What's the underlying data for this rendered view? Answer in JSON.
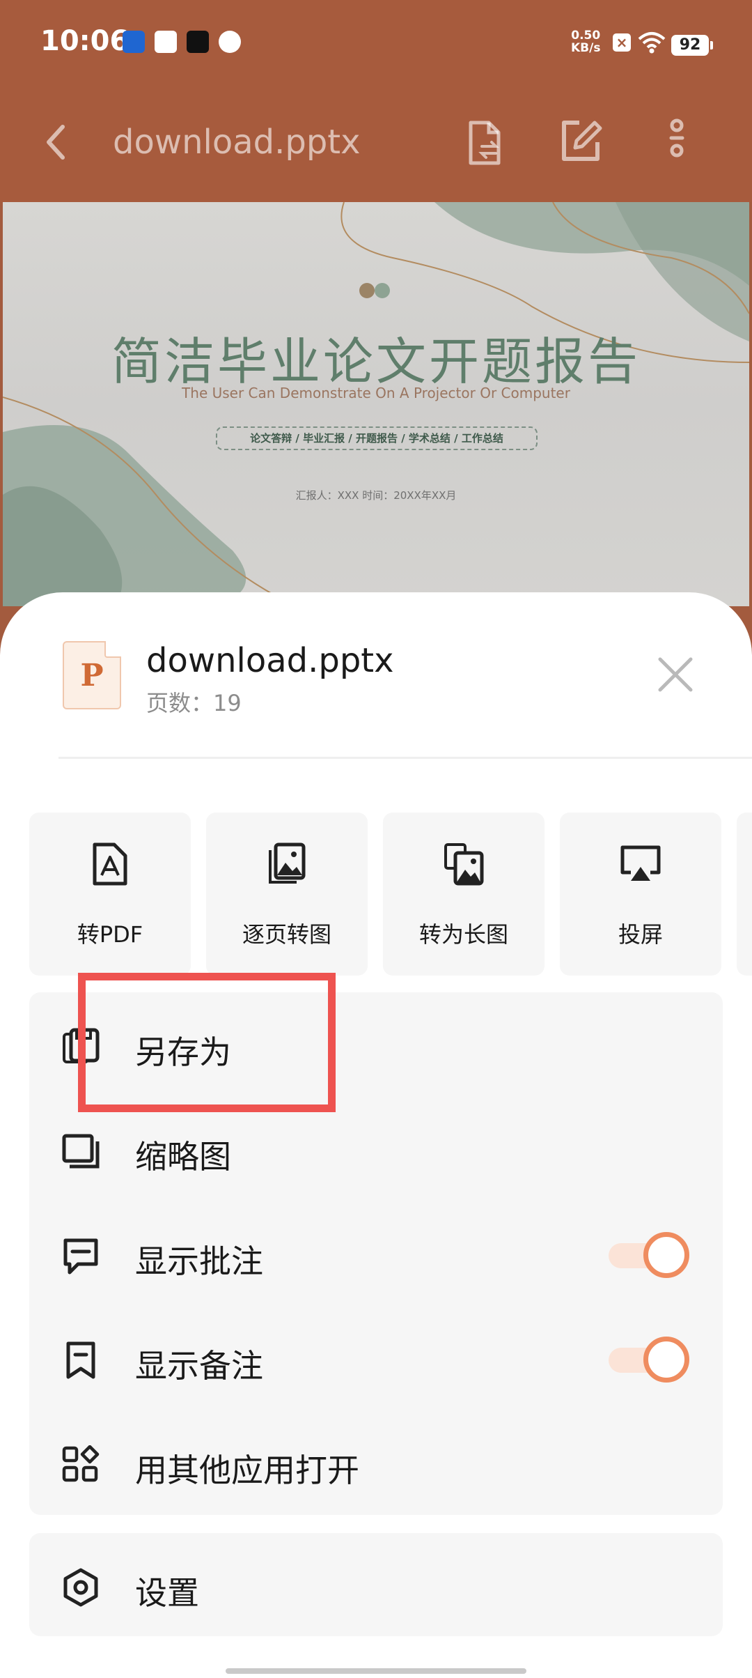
{
  "status_bar": {
    "time": "10:06",
    "net_speed_value": "0.50",
    "net_speed_unit": "KB/s",
    "battery": "92",
    "icons": [
      "baidu-icon",
      "mail-icon",
      "tiktok-icon",
      "browser-icon",
      "x-icon",
      "wifi-icon",
      "battery-icon"
    ]
  },
  "toolbar": {
    "title": "download.pptx",
    "icons": [
      "back-icon",
      "document-convert-icon",
      "edit-icon",
      "more-vertical-icon"
    ]
  },
  "slide": {
    "title": "简洁毕业论文开题报告",
    "subtitle": "The User Can Demonstrate On A Projector Or Computer",
    "tags": "论文答辩  / 毕业汇报  / 开题报告  / 学术总结  / 工作总结",
    "meta": "汇报人：XXX   时间：20XX年XX月"
  },
  "sheet": {
    "file_letter": "P",
    "file_name": "download.pptx",
    "page_count": "页数：19",
    "actions": [
      {
        "label": "转PDF",
        "icon": "pdf-icon"
      },
      {
        "label": "逐页转图",
        "icon": "page-images-icon"
      },
      {
        "label": "转为长图",
        "icon": "long-image-icon"
      },
      {
        "label": "投屏",
        "icon": "cast-icon"
      }
    ],
    "menu": [
      {
        "label": "另存为",
        "icon": "save-as-icon"
      },
      {
        "label": "缩略图",
        "icon": "thumbnail-icon"
      },
      {
        "label": "显示批注",
        "icon": "comment-icon",
        "toggle": true
      },
      {
        "label": "显示备注",
        "icon": "notes-icon",
        "toggle": true
      },
      {
        "label": "用其他应用打开",
        "icon": "apps-icon"
      }
    ],
    "settings_label": "设置"
  },
  "colors": {
    "brand": "#a75b3d",
    "accent": "#ef8c5f",
    "highlight": "#ee5350",
    "sheet_item_bg": "#f6f6f6"
  }
}
